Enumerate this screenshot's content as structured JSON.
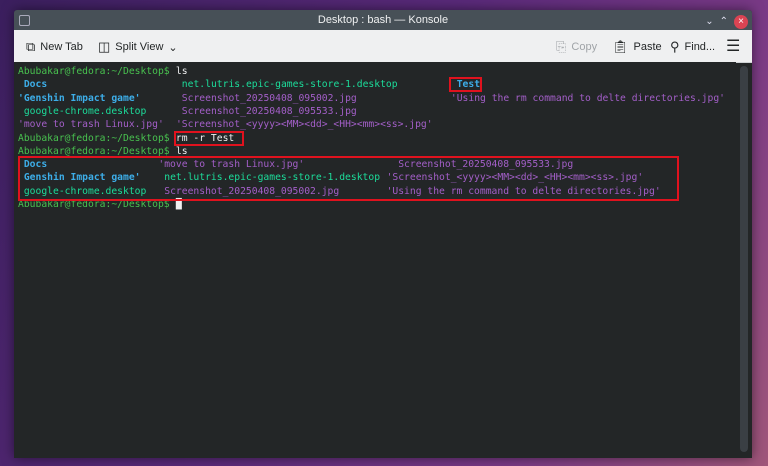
{
  "window": {
    "title": "Desktop : bash — Konsole"
  },
  "toolbar": {
    "new_tab": "New Tab",
    "split_view": "Split View",
    "copy": "Copy",
    "paste": "Paste",
    "find": "Find..."
  },
  "colors": {
    "prompt": "#48c14f",
    "directory": "#3daee9",
    "desktop_file": "#1cdc9a",
    "image_file": "#a35fc8",
    "highlight": "#e0121e",
    "background": "#232627"
  },
  "terminal": {
    "lines": [
      [
        {
          "text": "Abubakar@fedora:~/Desktop$",
          "type": "prompt",
          "col": 0
        },
        {
          "text": " ls",
          "type": "plain",
          "col": 26
        }
      ],
      [
        {
          "text": " Docs",
          "type": "dir",
          "col": 0
        },
        {
          "text": "net.lutris.epic-games-store-1.desktop",
          "type": "desk",
          "col": 28
        },
        {
          "text": " Test",
          "type": "dir",
          "col": 74
        }
      ],
      [
        {
          "text": "'Genshin Impact game'",
          "type": "dir",
          "col": 0
        },
        {
          "text": "Screenshot_20250408_095002.jpg",
          "type": "img",
          "col": 28
        },
        {
          "text": "'Using the rm command to delte directories.jpg'",
          "type": "img",
          "col": 74
        }
      ],
      [
        {
          "text": " google-chrome.desktop",
          "type": "desk",
          "col": 0
        },
        {
          "text": "Screenshot_20250408_095533.jpg",
          "type": "img",
          "col": 28
        }
      ],
      [
        {
          "text": "'move to trash Linux.jpg'",
          "type": "img",
          "col": 0
        },
        {
          "text": "'Screenshot_<yyyy><MM><dd>_<HH><mm><ss>.jpg'",
          "type": "img",
          "col": 27
        }
      ],
      [
        {
          "text": "Abubakar@fedora:~/Desktop$",
          "type": "prompt",
          "col": 0
        },
        {
          "text": " rm -r Test",
          "type": "plain",
          "col": 26
        }
      ],
      [
        {
          "text": "Abubakar@fedora:~/Desktop$",
          "type": "prompt",
          "col": 0
        },
        {
          "text": " ls",
          "type": "plain",
          "col": 26
        }
      ],
      [
        {
          "text": " Docs",
          "type": "dir",
          "col": 0
        },
        {
          "text": "'move to trash Linux.jpg'",
          "type": "img",
          "col": 24
        },
        {
          "text": " Screenshot_20250408_095533.jpg",
          "type": "img",
          "col": 64
        }
      ],
      [
        {
          "text": " Genshin Impact game'",
          "type": "dir",
          "col": 0
        },
        {
          "text": "net.lutris.epic-games-store-1.desktop",
          "type": "desk",
          "col": 25
        },
        {
          "text": "'Screenshot_<yyyy><MM><dd>_<HH><mm><ss>.jpg'",
          "type": "img",
          "col": 63
        }
      ],
      [
        {
          "text": " google-chrome.desktop",
          "type": "desk",
          "col": 0
        },
        {
          "text": "Screenshot_20250408_095002.jpg",
          "type": "img",
          "col": 25
        },
        {
          "text": "'Using the rm command to delte directories.jpg'",
          "type": "img",
          "col": 63
        }
      ],
      [
        {
          "text": "Abubakar@fedora:~/Desktop$",
          "type": "prompt",
          "col": 0
        },
        {
          "text": " █",
          "type": "cur",
          "col": 26
        }
      ]
    ]
  }
}
